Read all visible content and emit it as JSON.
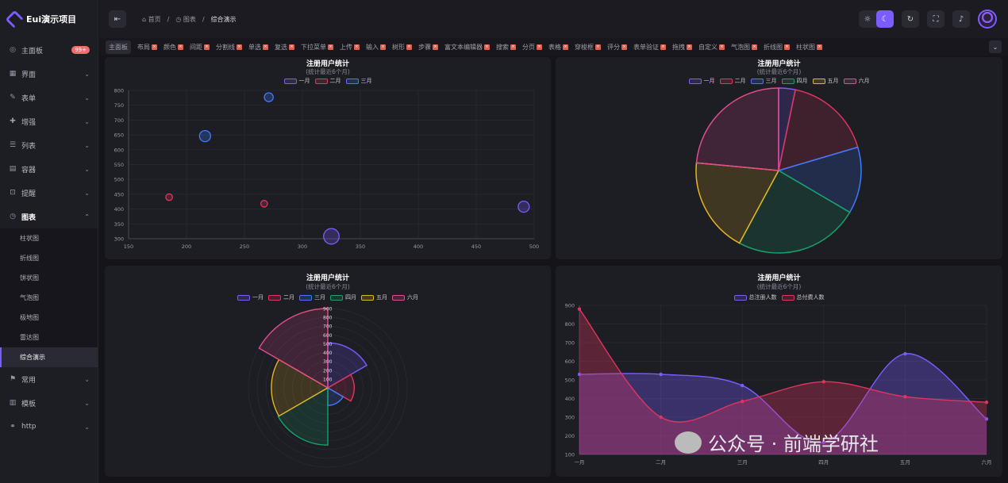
{
  "app": {
    "title": "Eui演示项目"
  },
  "sidebar": {
    "items": [
      {
        "label": "主面板",
        "icon": "dashboard-icon",
        "badge": "99+"
      },
      {
        "label": "界面",
        "icon": "layout-icon"
      },
      {
        "label": "表单",
        "icon": "form-icon"
      },
      {
        "label": "增强",
        "icon": "enhance-icon"
      },
      {
        "label": "列表",
        "icon": "list-icon"
      },
      {
        "label": "容器",
        "icon": "container-icon"
      },
      {
        "label": "提醒",
        "icon": "alert-icon"
      },
      {
        "label": "图表",
        "icon": "chart-icon",
        "open": true
      }
    ],
    "sub": [
      "柱状图",
      "折线图",
      "饼状图",
      "气泡图",
      "极地图",
      "雷达图",
      "综合演示"
    ],
    "after": [
      {
        "label": "常用",
        "icon": "common-icon"
      },
      {
        "label": "模板",
        "icon": "template-icon"
      },
      {
        "label": "http",
        "icon": "http-icon"
      }
    ]
  },
  "header": {
    "breadcrumb": [
      "首页",
      "图表",
      "综合演示"
    ],
    "separator": "/"
  },
  "tabs": [
    "主面板",
    "布局",
    "颜色",
    "间距",
    "分割线",
    "单选",
    "复选",
    "下拉菜单",
    "上传",
    "输入",
    "树形",
    "步骤",
    "富文本编辑器",
    "搜索",
    "分页",
    "表格",
    "穿梭框",
    "评分",
    "表单验证",
    "拖拽",
    "自定义",
    "气泡图",
    "折线图",
    "柱状图"
  ],
  "colors": {
    "m1": "#7b5cff",
    "m2": "#e0355f",
    "m3": "#3d7bff",
    "m4": "#16a36a",
    "m5": "#e6b422",
    "m6": "#e24b8d"
  },
  "common": {
    "title": "注册用户统计",
    "subtitle": "(统计最近6个月)"
  },
  "charts": {
    "bubble": {
      "legend": [
        "一月",
        "二月",
        "三月"
      ]
    },
    "pie": {
      "legend": [
        "一月",
        "二月",
        "三月",
        "四月",
        "五月",
        "六月"
      ]
    },
    "polar": {
      "legend": [
        "一月",
        "二月",
        "三月",
        "四月",
        "五月",
        "六月"
      ]
    },
    "line": {
      "legend": [
        "总注册人数",
        "总付费人数"
      ]
    }
  },
  "chart_data": [
    {
      "type": "scatter",
      "title": "注册用户统计",
      "subtitle": "(统计最近6个月)",
      "xlim": [
        150,
        500
      ],
      "ylim": [
        300,
        800
      ],
      "xticks": [
        150,
        200,
        250,
        300,
        350,
        400,
        450,
        500
      ],
      "yticks": [
        300,
        350,
        400,
        450,
        500,
        550,
        600,
        650,
        700,
        750,
        800
      ],
      "series": [
        {
          "name": "一月",
          "color": "#7b5cff",
          "points": [
            [
              325,
              308,
              7
            ],
            [
              491,
              408,
              5
            ]
          ]
        },
        {
          "name": "二月",
          "color": "#e0355f",
          "points": [
            [
              185,
              440,
              3
            ],
            [
              267,
              418,
              3
            ]
          ]
        },
        {
          "name": "三月",
          "color": "#3d7bff",
          "points": [
            [
              216,
              646,
              5
            ],
            [
              271,
              777,
              4
            ]
          ]
        }
      ]
    },
    {
      "type": "pie",
      "title": "注册用户统计",
      "subtitle": "(统计最近6个月)",
      "labels": [
        "一月",
        "二月",
        "三月",
        "四月",
        "五月",
        "六月"
      ],
      "values": [
        18,
        95,
        72,
        135,
        103,
        130
      ]
    },
    {
      "type": "polar",
      "title": "注册用户统计",
      "subtitle": "(统计最近6个月)",
      "labels": [
        "一月",
        "二月",
        "三月",
        "四月",
        "五月",
        "六月"
      ],
      "values": [
        510,
        300,
        200,
        650,
        640,
        900
      ],
      "rticks": [
        100,
        200,
        300,
        400,
        500,
        600,
        700,
        800,
        900
      ],
      "rmax": 900
    },
    {
      "type": "area",
      "title": "注册用户统计",
      "subtitle": "(统计最近6个月)",
      "categories": [
        "一月",
        "二月",
        "三月",
        "四月",
        "五月",
        "六月"
      ],
      "ylim": [
        100,
        900
      ],
      "yticks": [
        100,
        200,
        300,
        400,
        500,
        600,
        700,
        800,
        900
      ],
      "series": [
        {
          "name": "总注册人数",
          "color": "#7b5cff",
          "values": [
            530,
            530,
            470,
            165,
            640,
            290
          ]
        },
        {
          "name": "总付费人数",
          "color": "#e0355f",
          "values": [
            880,
            300,
            385,
            490,
            410,
            380
          ]
        }
      ]
    }
  ],
  "watermark": {
    "text": "公众号 · 前端学研社"
  }
}
